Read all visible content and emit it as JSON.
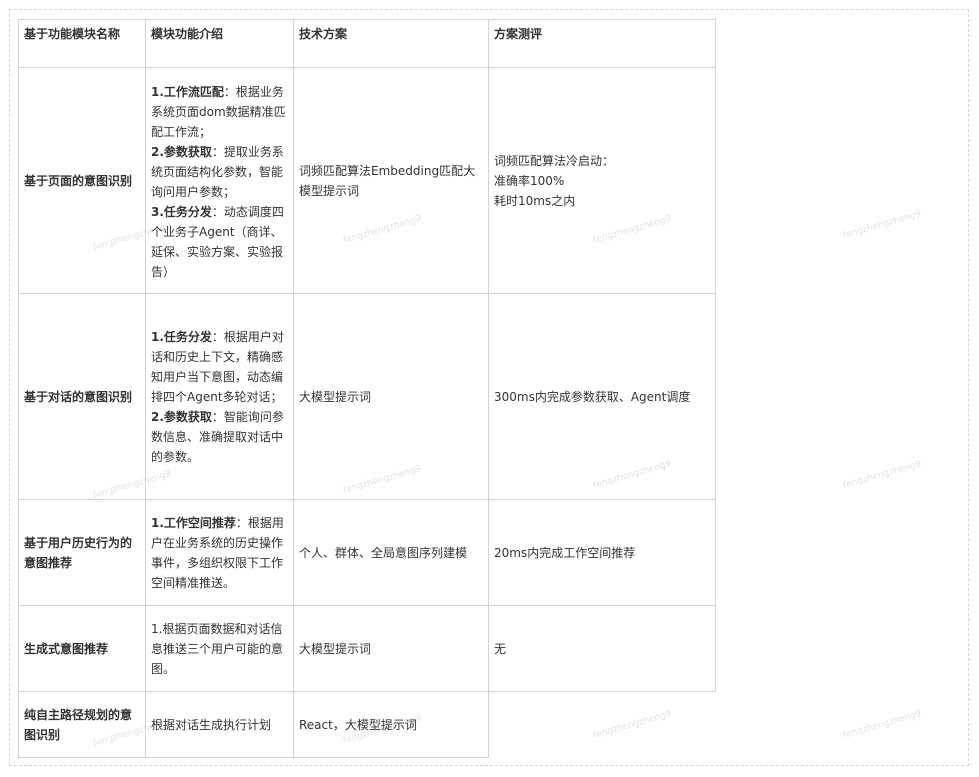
{
  "table": {
    "headers": [
      "基于功能模块名称",
      "模块功能介绍",
      "技术方案",
      "方案测评"
    ],
    "rows": [
      {
        "name": "基于页面的意图识别",
        "intro": [
          {
            "label": "1.工作流匹配",
            "text": "：根据业务系统页面dom数据精准匹配工作流；"
          },
          {
            "label": "2.参数获取",
            "text": "：提取业务系统页面结构化参数，智能询问用户参数；"
          },
          {
            "label": "3.任务分发",
            "text": "：动态调度四个业务子Agent（商详、延保、实验方案、实验报告）"
          }
        ],
        "tech": "词频匹配算法Embedding匹配大模型提示词",
        "eval": [
          "词频匹配算法冷启动：",
          "准确率100%",
          "耗时10ms之内"
        ]
      },
      {
        "name": "基于对话的意图识别",
        "intro": [
          {
            "label": "1.任务分发",
            "text": "：根据用户对话和历史上下文，精确感知用户当下意图，动态编排四个Agent多轮对话；"
          },
          {
            "label": "2.参数获取",
            "text": "：智能询问参数信息、准确提取对话中的参数。"
          }
        ],
        "tech": "大模型提示词",
        "eval": [
          "300ms内完成参数获取、Agent调度"
        ]
      },
      {
        "name": "基于用户历史行为的意图推荐",
        "intro": [
          {
            "label": "1.工作空间推荐",
            "text": "：根据用户在业务系统的历史操作事件，多组织权限下工作空间精准推送。"
          }
        ],
        "tech": "个人、群体、全局意图序列建模",
        "eval": [
          "20ms内完成工作空间推荐"
        ]
      },
      {
        "name": "生成式意图推荐",
        "intro": [
          {
            "label": "",
            "text": "1.根据页面数据和对话信息推送三个用户可能的意图。"
          }
        ],
        "tech": "大模型提示词",
        "eval": [
          "无"
        ]
      },
      {
        "name": "纯自主路径规划的意图识别",
        "intro": [
          {
            "label": "",
            "text": "根据对话生成执行计划"
          }
        ],
        "tech": "React，大模型提示词",
        "eval": []
      }
    ]
  },
  "watermark": "fengzhengzheng9"
}
